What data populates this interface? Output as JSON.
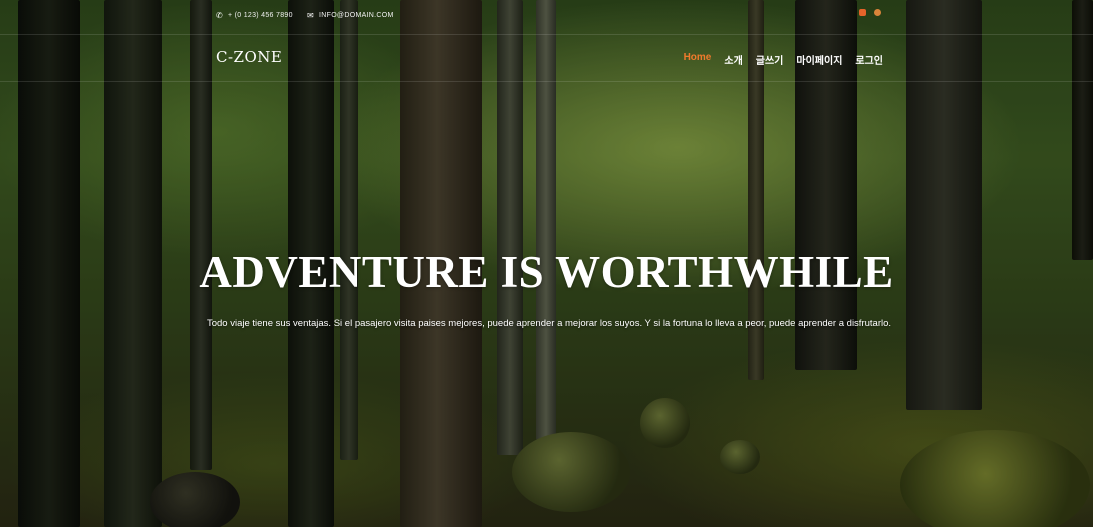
{
  "topbar": {
    "phone": "+ (0 123) 456 7890",
    "email": "INFO@DOMAIN.COM",
    "phone_icon": "phone-icon",
    "mail_icon": "envelope-icon",
    "social_icons": [
      "social-icon",
      "social-icon"
    ]
  },
  "nav": {
    "logo": "C-ZONE",
    "items": [
      {
        "label": "Home"
      },
      {
        "label": "소개"
      },
      {
        "label": "글쓰기"
      },
      {
        "label": "마이페이지"
      },
      {
        "label": "로그인"
      }
    ],
    "active_color": "#f07a2c"
  },
  "hero": {
    "title": "ADVENTURE IS WORTHWHILE",
    "text": "Todo viaje tiene sus ventajas. Si el pasajero visita paises mejores, puede aprender a mejorar los suyos. Y si la fortuna lo lleva a peor, puede aprender a disfrutarlo."
  }
}
